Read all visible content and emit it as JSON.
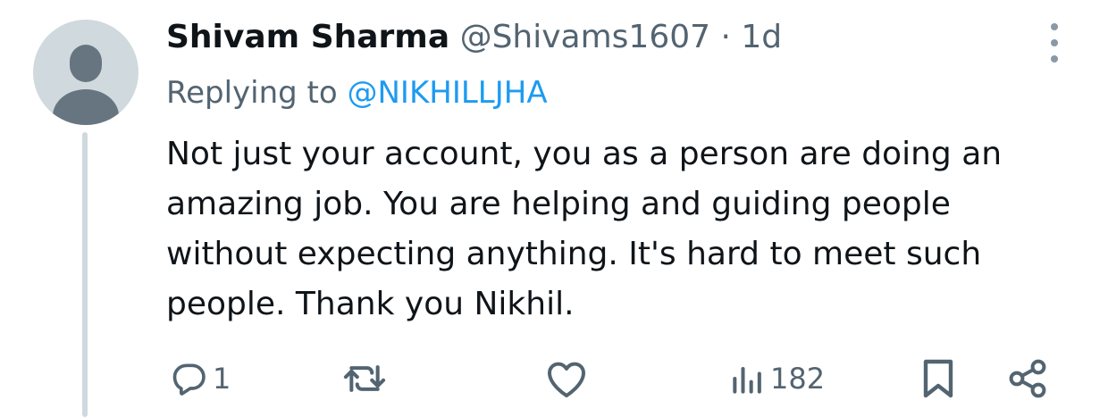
{
  "tweet": {
    "author_name": "Shivam Sharma",
    "author_handle": "@Shivams1607",
    "separator": "·",
    "time": "1d",
    "replying_prefix": "Replying to",
    "replying_to": "@NIKHILLJHA",
    "text": "Not just your account, you as a person are doing an amazing job. You are helping and guiding people without expecting anything. It's hard to meet such people. Thank you Nikhil."
  },
  "actions": {
    "reply_count": "1",
    "views_count": "182"
  },
  "icons": {
    "more": "more-vertical-icon",
    "reply": "reply-icon",
    "retweet": "retweet-icon",
    "like": "heart-icon",
    "views": "views-icon",
    "bookmark": "bookmark-icon",
    "share": "share-icon"
  },
  "colors": {
    "text": "#0f1419",
    "secondary": "#536471",
    "link": "#1d9bf0",
    "avatar_bg": "#cfd9de",
    "avatar_fg": "#66757f"
  }
}
